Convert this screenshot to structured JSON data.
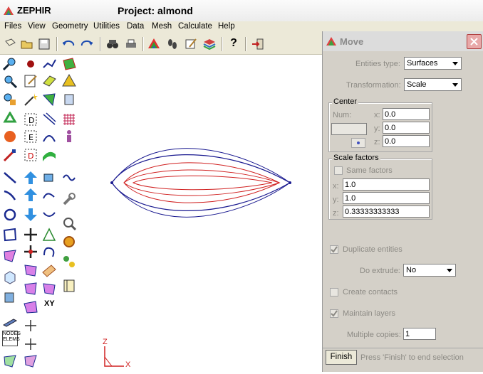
{
  "window": {
    "app_name": "ZEPHIR",
    "project_title": "Project: almond"
  },
  "menu": [
    "Files",
    "View",
    "Geometry",
    "Utilities",
    "Data",
    "Mesh",
    "Calculate",
    "Help"
  ],
  "toolbar": {
    "help_label": "?"
  },
  "palette": {
    "xy_label": "XY",
    "nodes_elems_label": "NODES ELEMS"
  },
  "axes": {
    "z_label": "Z",
    "x_label": "X"
  },
  "dialog": {
    "title": "Move",
    "entities_type_label": "Entities type:",
    "entities_type_value": "Surfaces",
    "transformation_label": "Transformation:",
    "transformation_value": "Scale",
    "center": {
      "title": "Center",
      "num_label": "Num:",
      "x_label": "x:",
      "x_value": "0.0",
      "y_label": "y:",
      "y_value": "0.0",
      "z_label": "z:",
      "z_value": "0.0"
    },
    "scale": {
      "title": "Scale factors",
      "same_factors_label": "Same factors",
      "x_label": "x:",
      "x_value": "1.0",
      "y_label": "y:",
      "y_value": "1.0",
      "z_label": "z:",
      "z_value": "0.33333333333"
    },
    "duplicate_label": "Duplicate entities",
    "do_extrude_label": "Do extrude:",
    "do_extrude_value": "No",
    "create_contacts_label": "Create contacts",
    "maintain_layers_label": "Maintain layers",
    "multiple_copies_label": "Multiple copies:",
    "multiple_copies_value": "1",
    "finish_label": "Finish",
    "status_text": "Press 'Finish' to end selection"
  }
}
